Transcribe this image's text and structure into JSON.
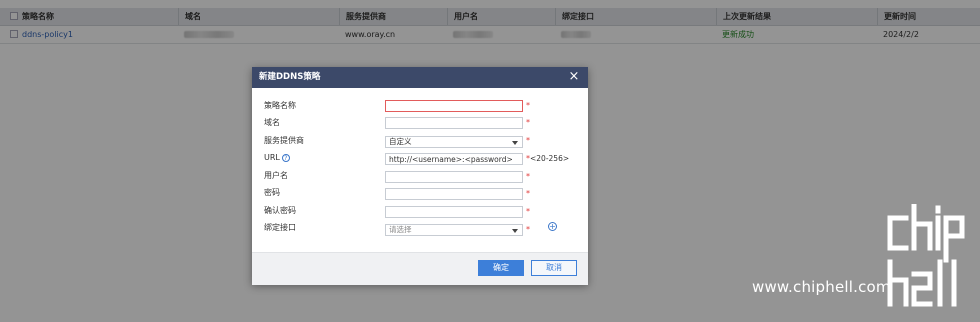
{
  "table": {
    "columns": [
      "策略名称",
      "域名",
      "服务提供商",
      "用户名",
      "绑定接口",
      "上次更新结果",
      "更新时间"
    ],
    "rows": [
      {
        "policy_name": "ddns-policy1",
        "provider": "www.oray.cn",
        "result": "更新成功",
        "time": "2024/2/2"
      }
    ]
  },
  "dialog": {
    "title": "新建DDNS策略",
    "close_icon": "×",
    "fields": {
      "policy_name": {
        "label": "策略名称",
        "value": ""
      },
      "domain": {
        "label": "域名",
        "value": ""
      },
      "provider": {
        "label": "服务提供商",
        "value": "自定义"
      },
      "url": {
        "label": "URL",
        "help": "?",
        "value": "http://<username>:<password>",
        "hint": "<20-256>"
      },
      "username": {
        "label": "用户名",
        "value": ""
      },
      "password": {
        "label": "密码",
        "value": ""
      },
      "confirm_password": {
        "label": "确认密码",
        "value": ""
      },
      "bind_interface": {
        "label": "绑定接口",
        "placeholder": "请选择"
      }
    },
    "required_mark": "*",
    "add_icon": "+",
    "ok_label": "确定",
    "cancel_label": "取消"
  },
  "watermark": {
    "url": "www.chiphell.com",
    "logo_text": "chip hell"
  },
  "colors": {
    "header_bg": "#3c4969",
    "primary": "#3d7fd9",
    "success": "#2a8a2a",
    "link": "#2b5fb4",
    "error": "#e03a3a"
  }
}
